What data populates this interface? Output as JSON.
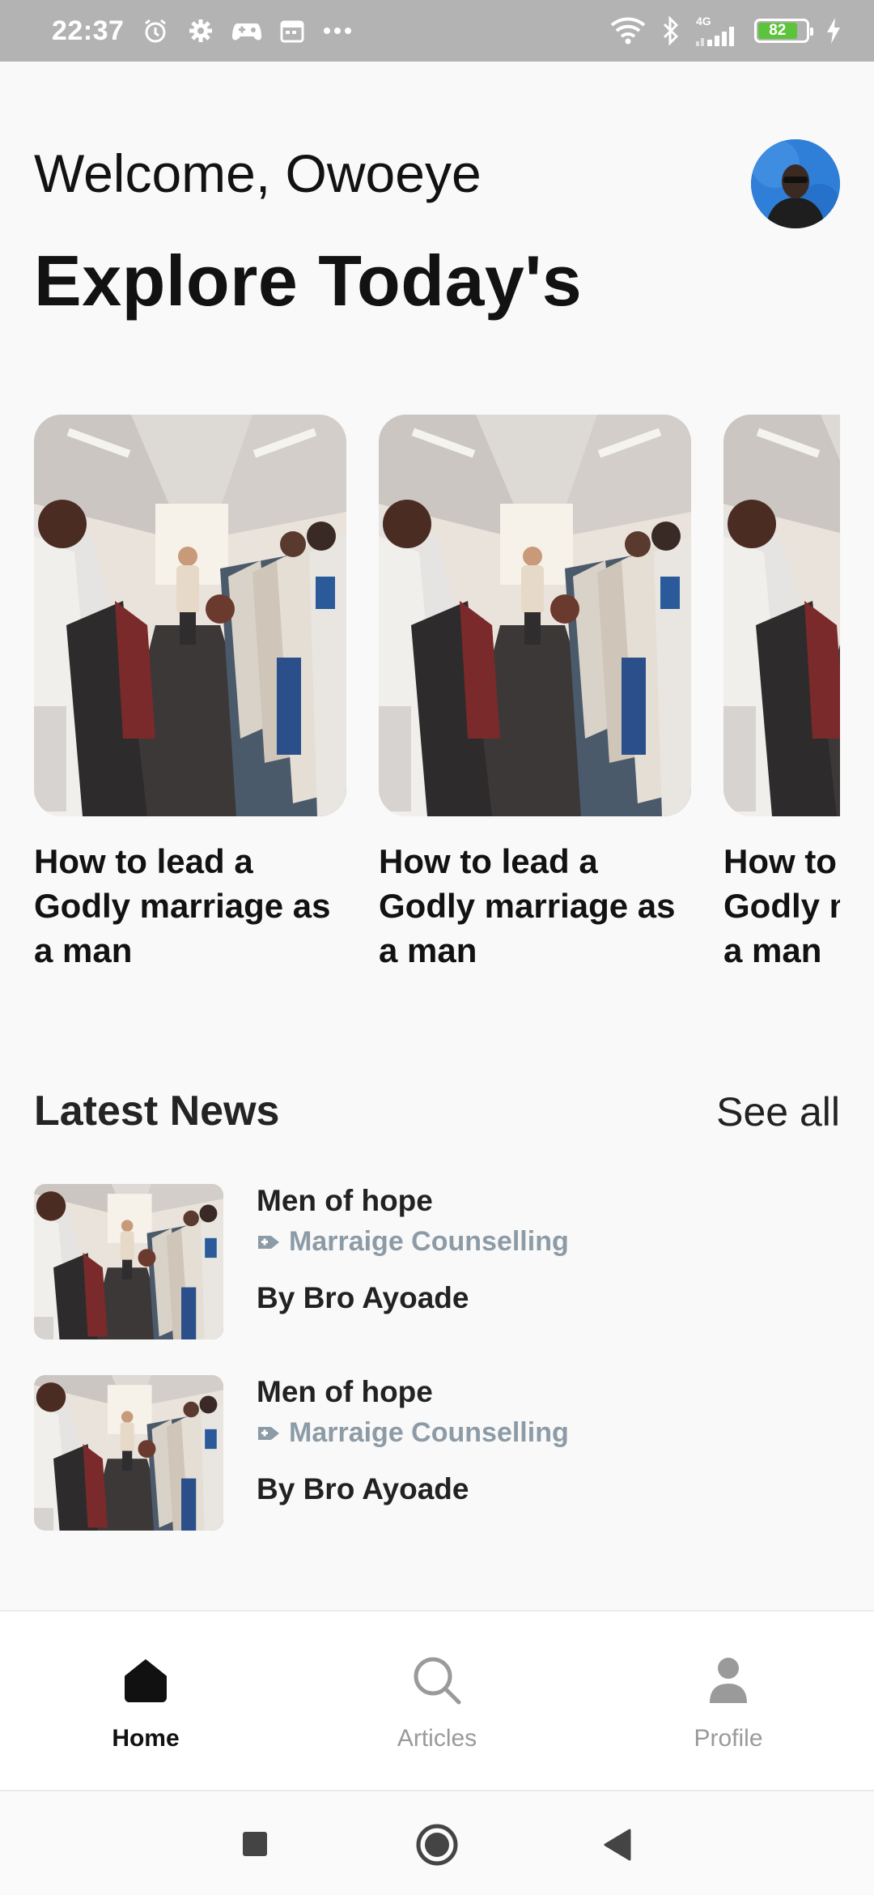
{
  "status_bar": {
    "time": "22:37",
    "network": "4G",
    "battery": "82",
    "battery_level": 0.82,
    "icons": [
      "alarm-icon",
      "settings-gear-icon",
      "game-controller-icon",
      "calendar-icon",
      "more-dots-icon",
      "wifi-icon",
      "bluetooth-icon",
      "signal-icon",
      "battery-icon",
      "charging-icon"
    ]
  },
  "header": {
    "welcome": "Welcome, Owoeye",
    "headline": "Explore Today's"
  },
  "carousel": {
    "cards": [
      {
        "title": "How to lead a Godly marriage as a man"
      },
      {
        "title": "How to lead a Godly marriage as a man"
      },
      {
        "title": "How to lead a Godly marriage as a man"
      }
    ]
  },
  "latest_news": {
    "title": "Latest News",
    "see_all": "See all",
    "items": [
      {
        "title": "Men of hope",
        "category": "Marraige Counselling",
        "author": "By Bro Ayoade"
      },
      {
        "title": "Men of hope",
        "category": "Marraige Counselling",
        "author": "By Bro Ayoade"
      }
    ]
  },
  "bottom_nav": {
    "items": [
      {
        "label": "Home",
        "icon": "home-icon",
        "active": true
      },
      {
        "label": "Articles",
        "icon": "search-icon",
        "active": false
      },
      {
        "label": "Profile",
        "icon": "person-icon",
        "active": false
      }
    ]
  },
  "colors": {
    "status_bar": "#b3b3b3",
    "background": "#f9f9f9",
    "category_text": "#8d9ba6",
    "active_nav": "#111111",
    "inactive_nav": "#9a9a9a",
    "battery_fill": "#5cc43a"
  }
}
